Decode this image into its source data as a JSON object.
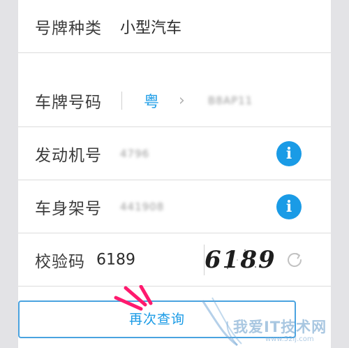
{
  "form": {
    "vehicle_type": {
      "label": "号牌种类",
      "value": "小型汽车"
    },
    "plate_number": {
      "label": "车牌号码",
      "province": "粤",
      "value": "B8AP11"
    },
    "engine_number": {
      "label": "发动机号",
      "value": "4796"
    },
    "vin": {
      "label": "车身架号",
      "value": "441908"
    },
    "captcha": {
      "label": "校验码",
      "input_value": "6189",
      "image_text": "6189"
    }
  },
  "submit": {
    "label": "再次查询"
  },
  "watermark": {
    "text": "我爱IT技术网",
    "sub": "www.52ij.com"
  },
  "colors": {
    "accent": "#1a9be6",
    "button_border": "#4aa3e0",
    "text": "#3c3c3c",
    "background": "#e3e3e6"
  },
  "icons": {
    "info": "info-icon",
    "chevron": "chevron-right-icon",
    "refresh": "refresh-icon"
  }
}
